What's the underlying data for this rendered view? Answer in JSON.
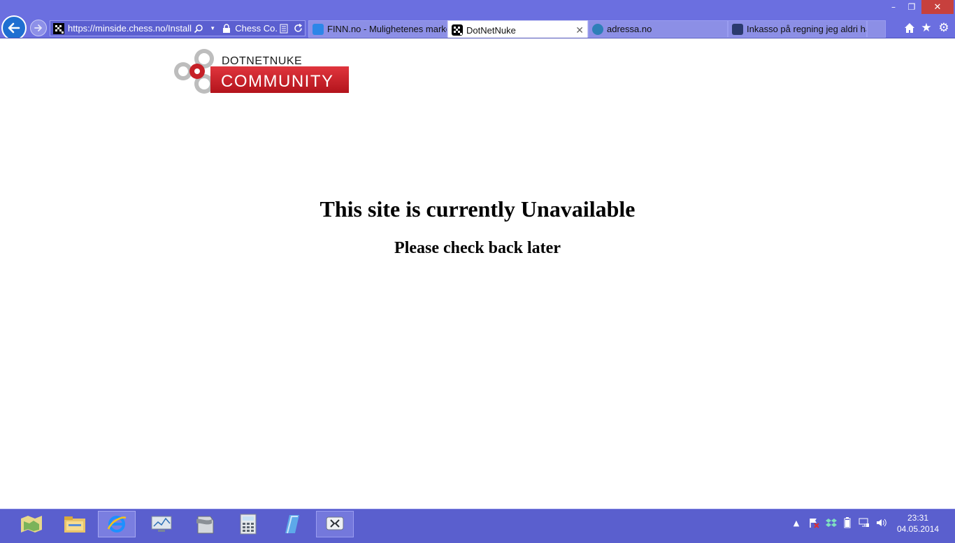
{
  "window": {
    "controls": {
      "minimize": "–",
      "restore": "❐",
      "close": "✕"
    }
  },
  "browser": {
    "address_bar": {
      "url": "https://minside.chess.no/Install/Ur",
      "certificate_label": "Chess Co..."
    },
    "tabs": [
      {
        "label": "FINN.no - Mulighetenes marked",
        "favicon": "finn-icon",
        "active": false
      },
      {
        "label": "DotNetNuke",
        "favicon": "dnn-icon",
        "active": true,
        "close": "✕"
      },
      {
        "label": "adressa.no",
        "favicon": "adressa-icon",
        "active": false
      },
      {
        "label": "Inkasso på regning jeg aldri ha...",
        "favicon": "inkasso-icon",
        "active": false
      }
    ],
    "toolbar_icons": [
      "home-icon",
      "favorites-star-icon",
      "settings-gear-icon"
    ],
    "accent_color": "#6b6fe0"
  },
  "page": {
    "logo": {
      "top_text": "DOTNETNUKE",
      "bottom_text": "COMMUNITY"
    },
    "headline": "This site is currently Unavailable",
    "subline": "Please check back later"
  },
  "taskbar": {
    "apps": [
      "explorer-map-icon",
      "file-explorer-icon",
      "internet-explorer-icon",
      "performance-monitor-icon",
      "terminal-icon",
      "calculator-icon",
      "notepad-icon",
      "xp-mode-icon"
    ],
    "tray_icons": [
      "show-hidden-icon",
      "action-center-icon",
      "dropbox-icon",
      "battery-icon",
      "network-icon",
      "volume-icon"
    ],
    "clock": {
      "time": "23:31",
      "date": "04.05.2014"
    }
  }
}
